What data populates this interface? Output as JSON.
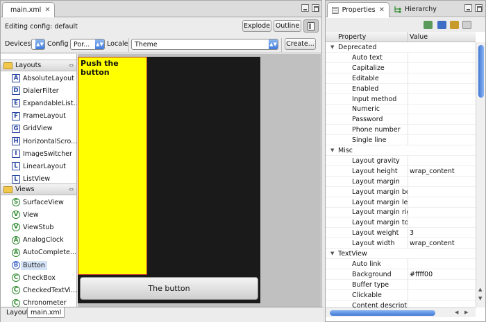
{
  "editor": {
    "tab_label": "main.xml",
    "tab_close": "✕",
    "editing_config": "Editing config:  default",
    "explode_label": "Explode",
    "outline_label": "Outline",
    "devices_label": "Devices",
    "devices_value": "",
    "config_label": "Config",
    "config_value": "Por...",
    "locale_label": "Locale",
    "theme_value": "Theme",
    "create_label": "Create..."
  },
  "palette": {
    "layouts_label": "Layouts",
    "layouts": [
      {
        "icon": "A",
        "label": "AbsoluteLayout"
      },
      {
        "icon": "D",
        "label": "DialerFilter"
      },
      {
        "icon": "E",
        "label": "ExpandableList..."
      },
      {
        "icon": "F",
        "label": "FrameLayout"
      },
      {
        "icon": "G",
        "label": "GridView"
      },
      {
        "icon": "H",
        "label": "HorizontalScro..."
      },
      {
        "icon": "I",
        "label": "ImageSwitcher"
      },
      {
        "icon": "L",
        "label": "LinearLayout"
      },
      {
        "icon": "L",
        "label": "ListView"
      }
    ],
    "views_label": "Views",
    "views": [
      {
        "icon": "S",
        "label": "SurfaceView"
      },
      {
        "icon": "V",
        "label": "View"
      },
      {
        "icon": "V",
        "label": "ViewStub"
      },
      {
        "icon": "A",
        "label": "AnalogClock"
      },
      {
        "icon": "A",
        "label": "AutoComplete..."
      },
      {
        "icon": "B",
        "label": "Button"
      },
      {
        "icon": "C",
        "label": "CheckBox"
      },
      {
        "icon": "C",
        "label": "CheckedTextVi..."
      },
      {
        "icon": "C",
        "label": "Chronometer"
      }
    ]
  },
  "canvas": {
    "push_text": "Push the button",
    "button_text": "The button",
    "yellow_color": "#ffff00"
  },
  "bottom_tabs": [
    "Layout",
    "main.xml"
  ],
  "properties": {
    "tab_label": "Properties",
    "hierarchy_label": "Hierarchy",
    "col_property": "Property",
    "col_value": "Value",
    "rows": [
      {
        "group": true,
        "key": "Deprecated",
        "value": ""
      },
      {
        "key": "Auto text",
        "value": ""
      },
      {
        "key": "Capitalize",
        "value": ""
      },
      {
        "key": "Editable",
        "value": ""
      },
      {
        "key": "Enabled",
        "value": ""
      },
      {
        "key": "Input method",
        "value": ""
      },
      {
        "key": "Numeric",
        "value": ""
      },
      {
        "key": "Password",
        "value": ""
      },
      {
        "key": "Phone number",
        "value": ""
      },
      {
        "key": "Single line",
        "value": ""
      },
      {
        "group": true,
        "key": "Misc",
        "value": ""
      },
      {
        "key": "Layout gravity",
        "value": ""
      },
      {
        "key": "Layout height",
        "value": "wrap_content"
      },
      {
        "key": "Layout margin",
        "value": ""
      },
      {
        "key": "Layout margin bottom",
        "value": ""
      },
      {
        "key": "Layout margin left",
        "value": ""
      },
      {
        "key": "Layout margin right",
        "value": ""
      },
      {
        "key": "Layout margin top",
        "value": ""
      },
      {
        "key": "Layout weight",
        "value": "3"
      },
      {
        "key": "Layout width",
        "value": "wrap_content"
      },
      {
        "group": true,
        "key": "TextView",
        "value": ""
      },
      {
        "key": "Auto link",
        "value": ""
      },
      {
        "key": "Background",
        "value": "#ffff00"
      },
      {
        "key": "Buffer type",
        "value": ""
      },
      {
        "key": "Clickable",
        "value": ""
      },
      {
        "key": "Content description",
        "value": ""
      }
    ]
  }
}
